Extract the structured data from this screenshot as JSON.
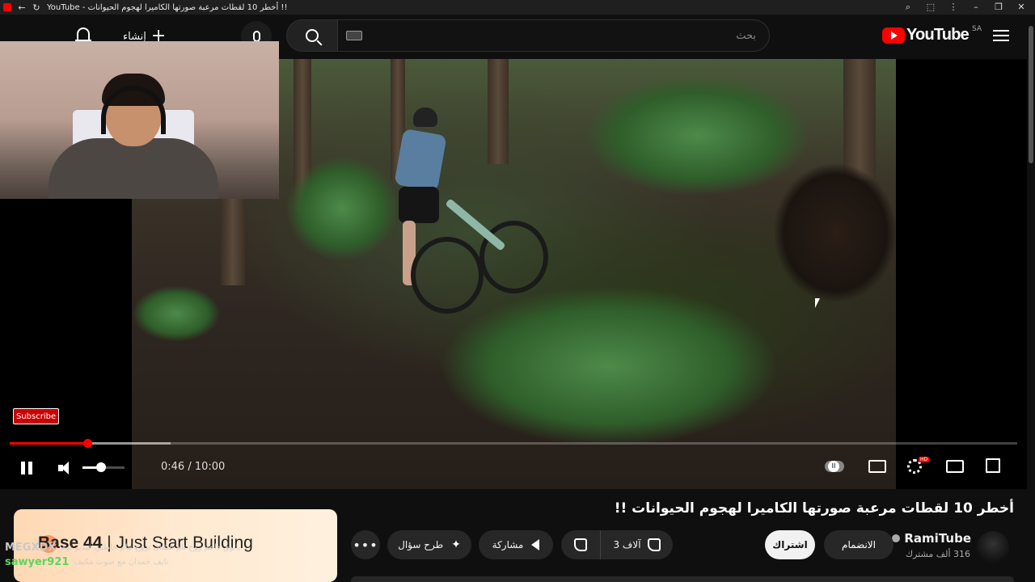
{
  "browser": {
    "tab_title": "YouTube - أخطر 10 لقطات مرعبة صورتها الكاميرا لهجوم الحيوانات !!"
  },
  "masthead": {
    "logo_text": "YouTube",
    "region_code": "SA",
    "search_placeholder": "بحث",
    "create_label": "إنشاء"
  },
  "player": {
    "subscribe_overlay": "Subscribe",
    "current_time": "0:46",
    "duration": "10:00",
    "time_display": "0:46 / 10:00",
    "progress_fraction": 0.077,
    "volume_fraction": 0.45,
    "settings_badge": "HD"
  },
  "video": {
    "title": "أخطر 10 لقطات مرعبة صورتها الكاميرا لهجوم الحيوانات !!",
    "channel_name": "RamiTube",
    "subscriber_count": "316 ألف مشترك",
    "join_label": "الانضمام",
    "subscribe_label": "اشتراك",
    "like_count": "3 آلاف",
    "share_label": "مشاركة",
    "ask_label": "طرح سؤال"
  },
  "ad": {
    "brand_bold": "Base 44",
    "brand_tagline": "Just Start Building"
  },
  "chat": [
    {
      "user": "MEGXDX",
      "message": "يابوي داحم روح نام عشان تروح تنام حاطني فيديو نوم"
    },
    {
      "user": "sawyer921",
      "message": "نايف حمدان مع صوت مكيف"
    }
  ],
  "colors": {
    "brand_red": "#ff0000",
    "background": "#0f0f0f",
    "button_bg": "#272727"
  }
}
